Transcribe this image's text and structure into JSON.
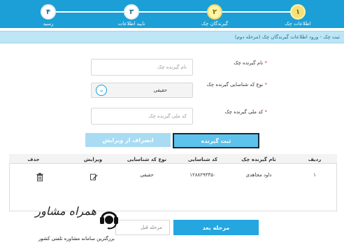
{
  "stepper": {
    "steps": [
      {
        "number": "۱",
        "label": "اطلاعات چک",
        "state": "done"
      },
      {
        "number": "۲",
        "label": "گیرندگان چک",
        "state": "active"
      },
      {
        "number": "۳",
        "label": "تایید اطلاعات",
        "state": "todo"
      },
      {
        "number": "۴",
        "label": "رسید",
        "state": "todo"
      }
    ]
  },
  "breadcrumb": "ثبت چک - ورود اطلاعات گیرندگان چک (مرحله دوم)",
  "form": {
    "name_label": "نام گیرنده چک",
    "name_placeholder": "نام گیرنده چک",
    "id_type_label": "نوع کد شناسایی گیرنده چک",
    "id_type_value": "حقیقی",
    "national_id_label": "کد ملی گیرنده چک",
    "national_id_placeholder": "کد ملی گیرنده چک",
    "required_mark": "*"
  },
  "buttons": {
    "submit_receiver": "ثبت گیرنده",
    "cancel_edit": "انصراف از ویرایش",
    "next_step": "مرحله بعد",
    "prev_step": "مرحله قبل"
  },
  "table": {
    "headers": [
      "ردیف",
      "نام گیرنده چک",
      "کد شناسایی",
      "نوع کد شناسایی",
      "ویرایش",
      "حذف"
    ],
    "rows": [
      {
        "index": "۱",
        "name": "داود مجاهدی",
        "id_code": "۱۲۸۸۲۹۴۴۵۰",
        "id_type": "حقیقی"
      }
    ]
  },
  "watermark": {
    "title": "همراه مشاور",
    "subtitle": "بزرگترین سامانه مشاوره تلفنی کشور"
  },
  "colors": {
    "primary": "#1b9fd6",
    "button": "#5ec3ec",
    "active_step": "#f6e07a"
  },
  "icons": {
    "chevron": "chevron-down-icon",
    "edit": "pencil-icon",
    "delete": "trash-icon"
  }
}
